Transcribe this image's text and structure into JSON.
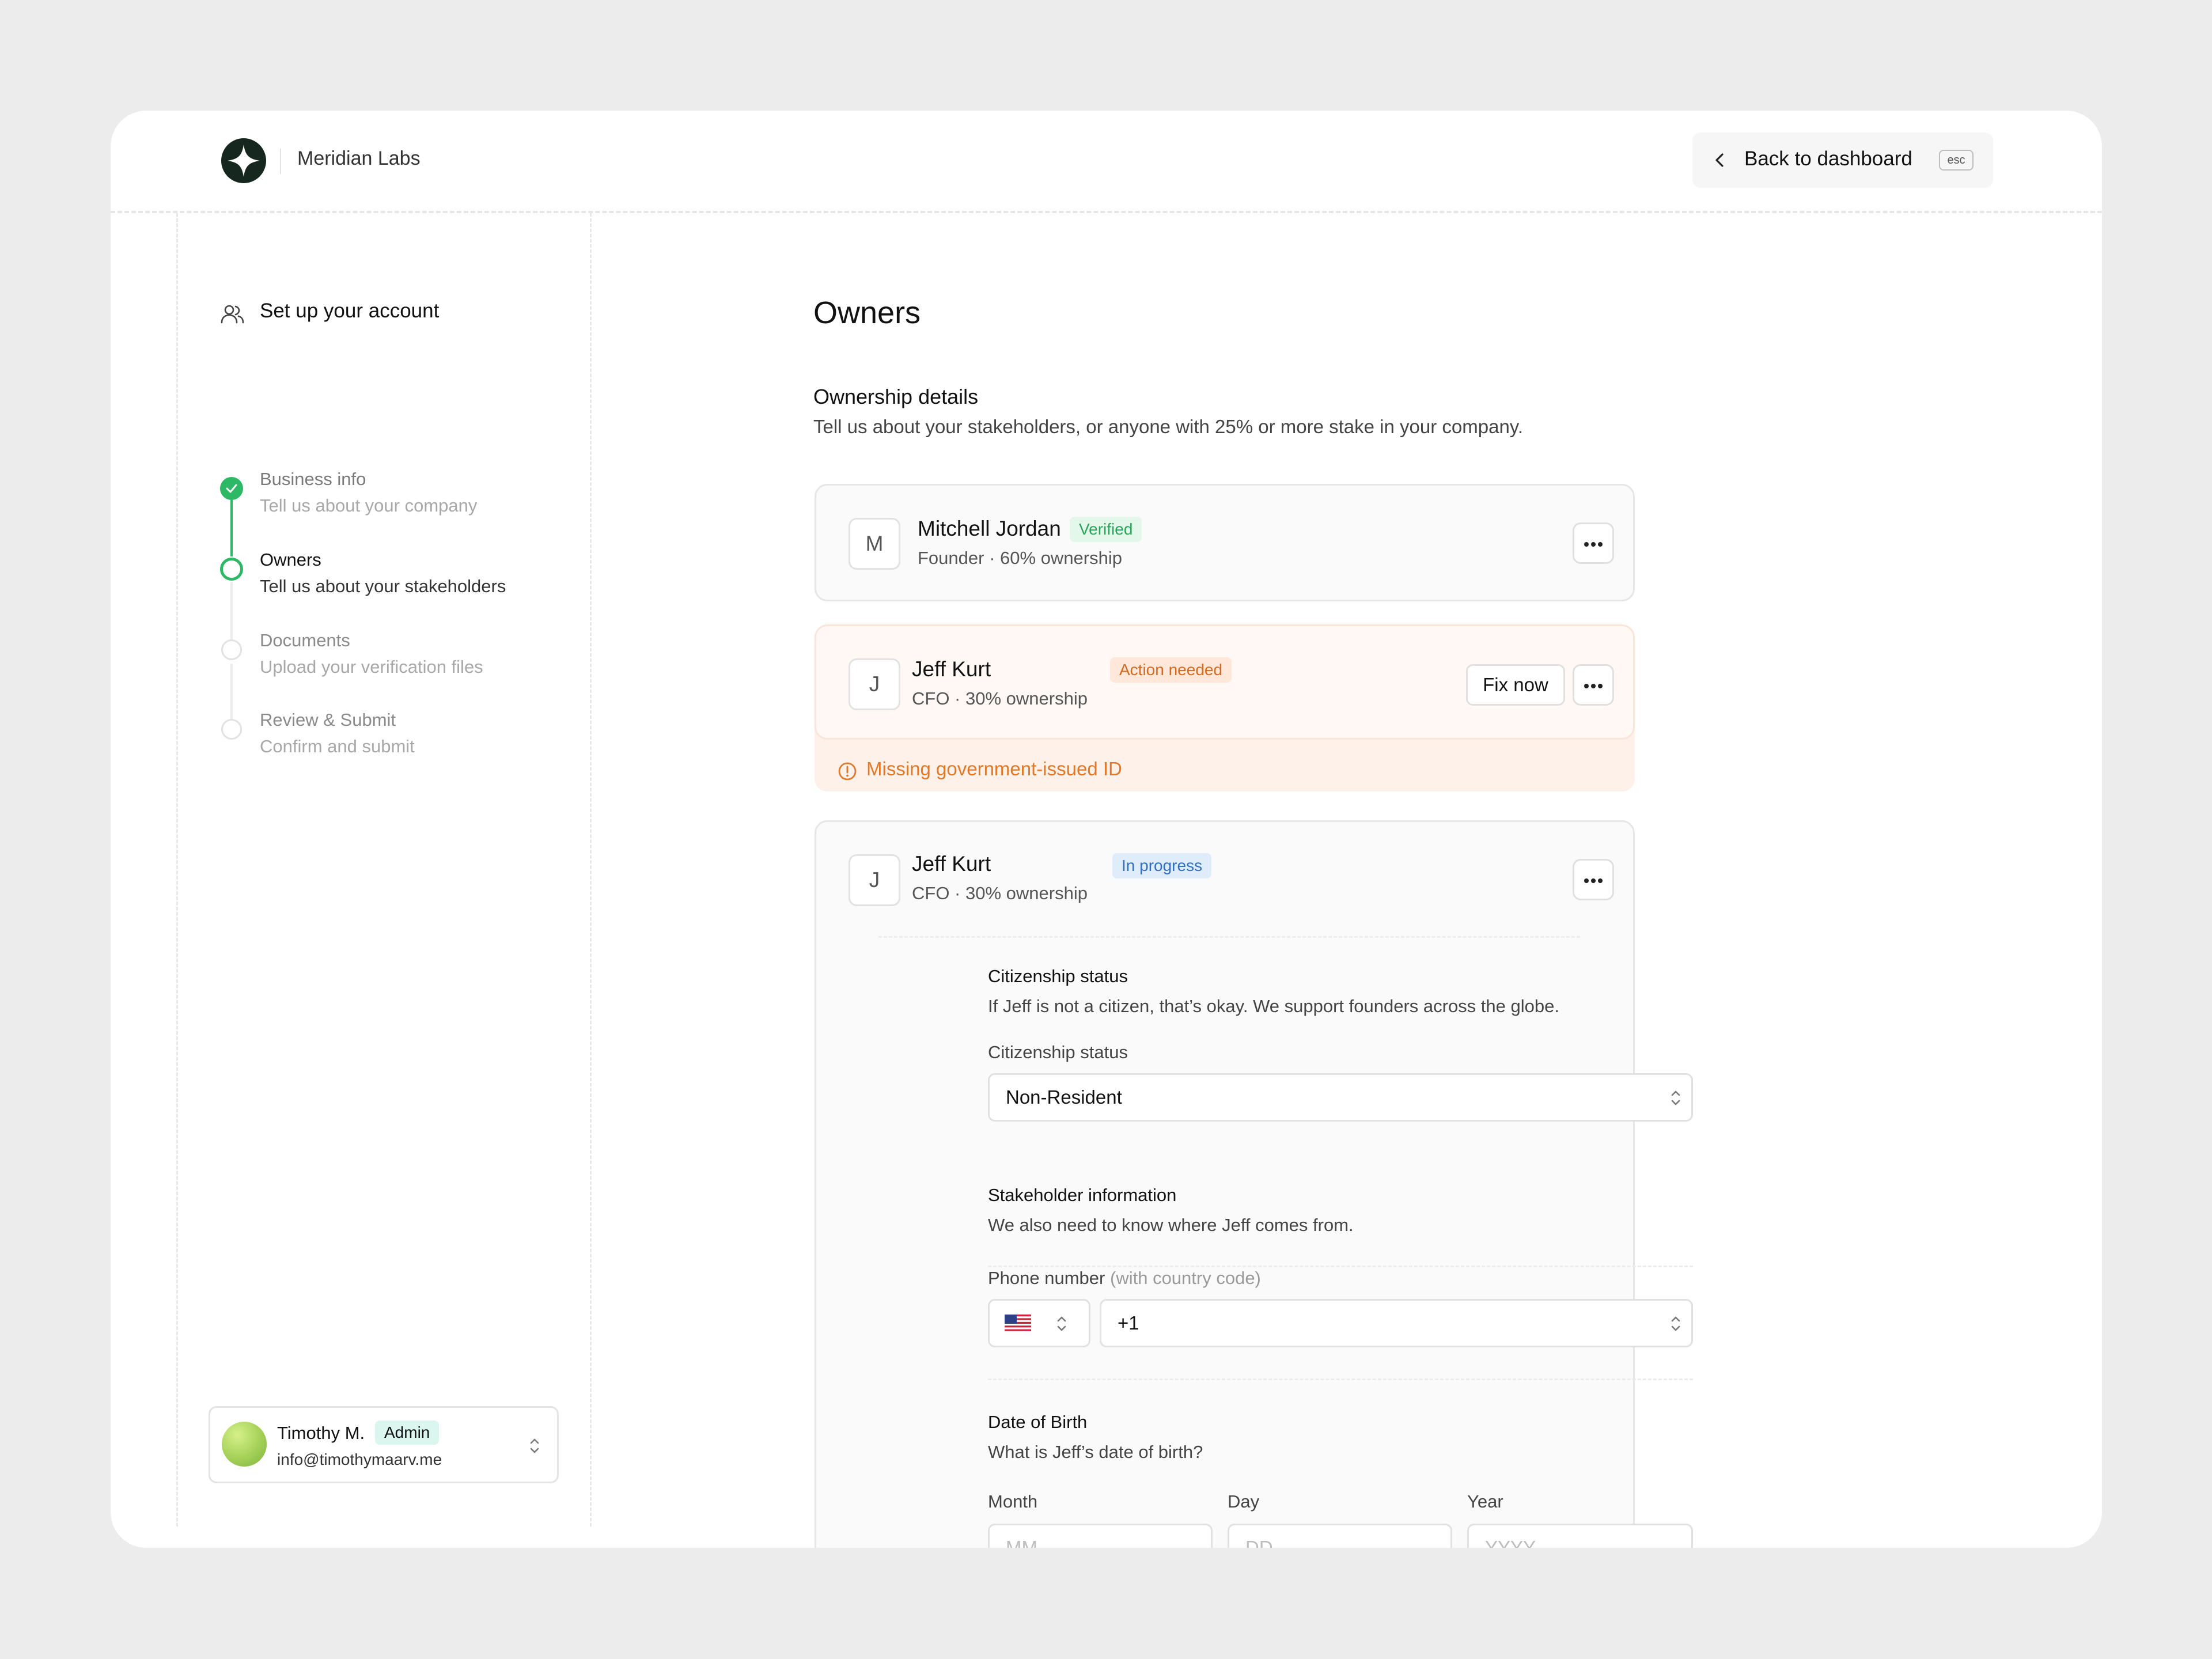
{
  "brand": {
    "name": "Meridian Labs"
  },
  "header": {
    "back_label": "Back to dashboard",
    "shortcut": "esc"
  },
  "sidebar": {
    "title": "Set up your account",
    "steps": [
      {
        "title": "Business info",
        "description": "Tell us about your company",
        "status": "done"
      },
      {
        "title": "Owners",
        "description": "Tell us about your stakeholders",
        "status": "active"
      },
      {
        "title": "Documents",
        "description": "Upload your verification files",
        "status": "todo"
      },
      {
        "title": "Review & Submit",
        "description": "Confirm and submit",
        "status": "todo"
      }
    ],
    "user": {
      "name": "Timothy M.",
      "role": "Admin",
      "email": "info@timothymaarv.me"
    }
  },
  "main": {
    "title": "Owners",
    "section_title": "Ownership details",
    "section_description": "Tell us about your stakeholders, or anyone with 25% or more stake in your company.",
    "owners": [
      {
        "initial": "M",
        "name": "Mitchell Jordan",
        "status": "Verified",
        "role": "Founder",
        "ownership": "60% ownership"
      },
      {
        "initial": "J",
        "name": "Jeff Kurt",
        "status": "Action needed",
        "role": "CFO",
        "ownership": "30% ownership",
        "action_label": "Fix now",
        "warning": "Missing government-issued ID"
      },
      {
        "initial": "J",
        "name": "Jeff Kurt",
        "status": "In progress",
        "role": "CFO",
        "ownership": "30% ownership"
      }
    ],
    "form": {
      "citizenship": {
        "title": "Citizenship status",
        "description": "If Jeff is not a citizen, that’s okay. We support founders across the globe.",
        "label": "Citizenship status",
        "value": "Non-Resident"
      },
      "stakeholder": {
        "title": "Stakeholder information",
        "description": "We also need to know where Jeff comes from.",
        "phone_label": "Phone number",
        "phone_hint": "(with country code)",
        "phone_code": "+1",
        "flag_icon": "us-flag-icon"
      },
      "dob": {
        "title": "Date of Birth",
        "description": "What is Jeff’s date of birth?",
        "month_label": "Month",
        "month_placeholder": "MM",
        "day_label": "Day",
        "day_placeholder": "DD",
        "year_label": "Year",
        "year_placeholder": "YYYY"
      }
    }
  },
  "colors": {
    "accent": "#2db866",
    "warning": "#e07a2a",
    "info": "#2f6fc0",
    "background": "#ececec"
  }
}
